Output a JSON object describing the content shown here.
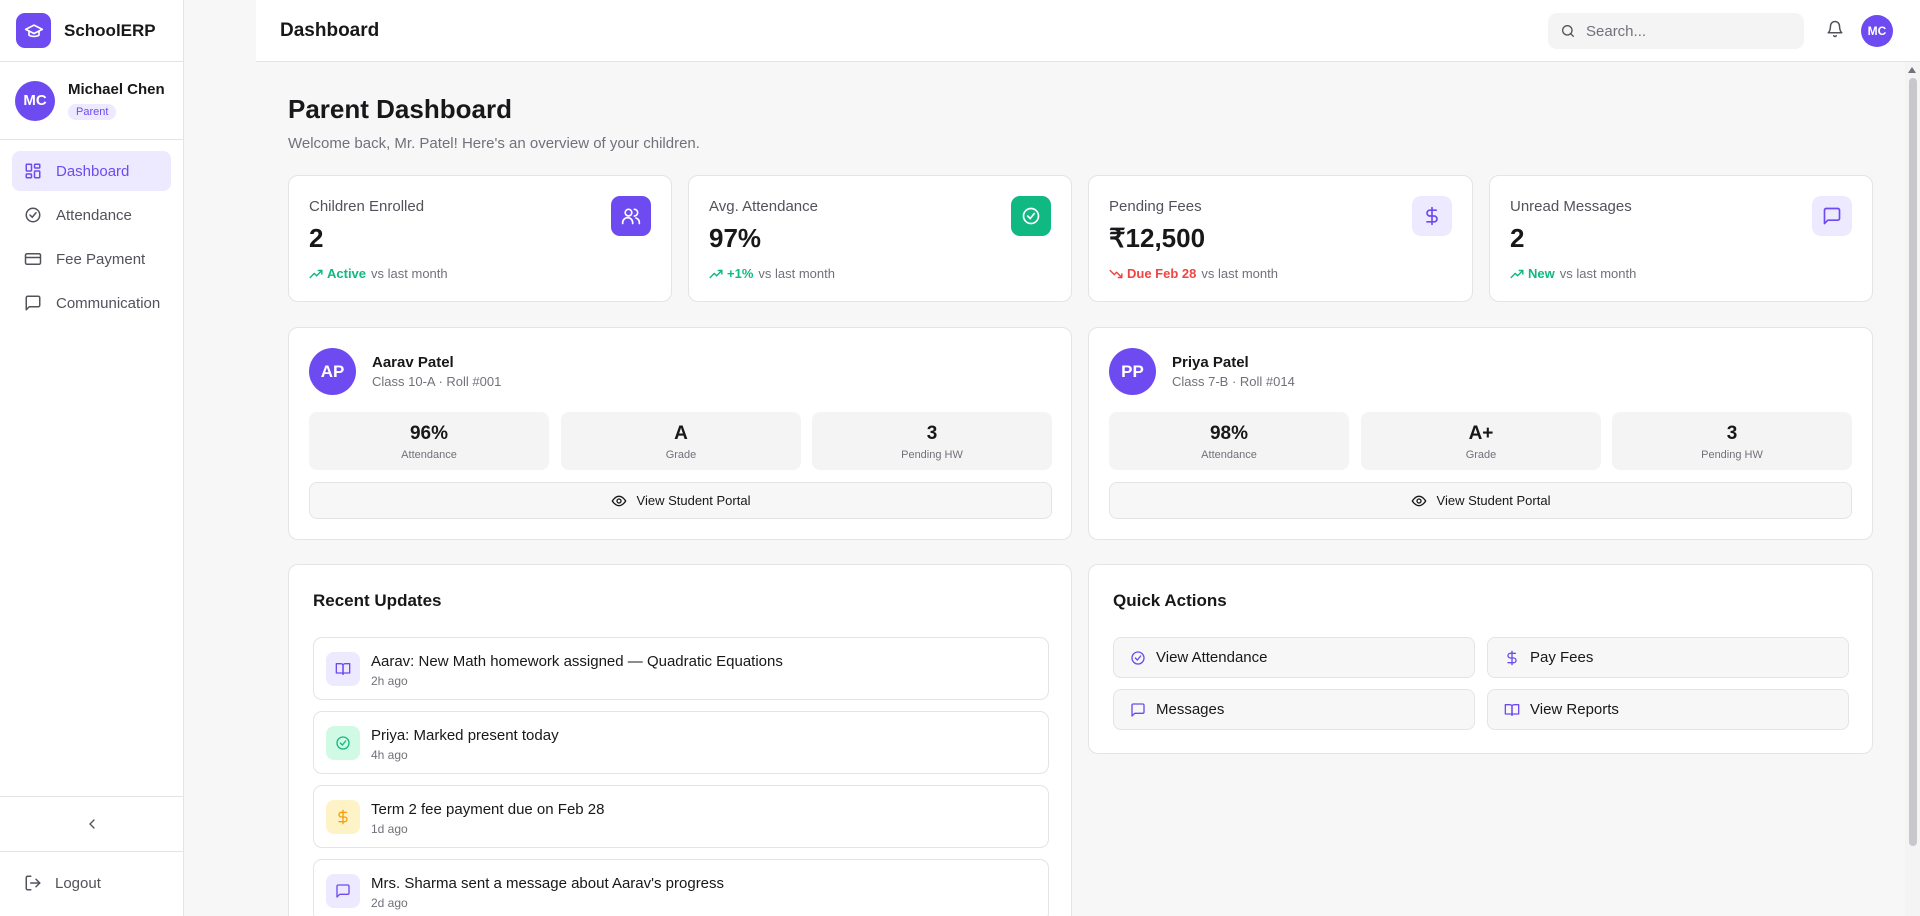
{
  "app": {
    "name": "SchoolERP",
    "logo_icon": "graduation-cap-icon"
  },
  "user": {
    "initials": "MC",
    "name": "Michael Chen",
    "role": "Parent"
  },
  "sidebar": {
    "items": [
      {
        "label": "Dashboard",
        "icon": "dashboard-icon",
        "active": true
      },
      {
        "label": "Attendance",
        "icon": "check-circle-icon",
        "active": false
      },
      {
        "label": "Fee Payment",
        "icon": "credit-card-icon",
        "active": false
      },
      {
        "label": "Communication",
        "icon": "message-icon",
        "active": false
      }
    ],
    "collapse_icon": "chevron-left-icon",
    "logout_label": "Logout"
  },
  "header": {
    "title": "Dashboard",
    "search_placeholder": "Search...",
    "avatar_initials": "MC"
  },
  "page": {
    "title": "Parent Dashboard",
    "subtitle": "Welcome back, Mr. Patel! Here's an overview of your children."
  },
  "stats": [
    {
      "label": "Children Enrolled",
      "value": "2",
      "trend_value": "Active",
      "trend_text": "vs last month",
      "trend": "up",
      "icon": "users-icon",
      "icon_bg": "#6d4bf0"
    },
    {
      "label": "Avg. Attendance",
      "value": "97%",
      "trend_value": "+1%",
      "trend_text": "vs last month",
      "trend": "up",
      "icon": "check-circle-icon",
      "icon_bg": "#10b981"
    },
    {
      "label": "Pending Fees",
      "value": "₹12,500",
      "trend_value": "Due Feb 28",
      "trend_text": "vs last month",
      "trend": "down",
      "icon": "dollar-icon",
      "icon_bg": "#ede9fe"
    },
    {
      "label": "Unread Messages",
      "value": "2",
      "trend_value": "New",
      "trend_text": "vs last month",
      "trend": "up",
      "icon": "message-icon",
      "icon_bg": "#ede9fe"
    }
  ],
  "children": [
    {
      "initials": "AP",
      "name": "Aarav Patel",
      "meta": "Class 10-A · Roll #001",
      "metrics": [
        {
          "value": "96%",
          "label": "Attendance"
        },
        {
          "value": "A",
          "label": "Grade"
        },
        {
          "value": "3",
          "label": "Pending HW"
        }
      ],
      "button": "View Student Portal"
    },
    {
      "initials": "PP",
      "name": "Priya Patel",
      "meta": "Class 7-B · Roll #014",
      "metrics": [
        {
          "value": "98%",
          "label": "Attendance"
        },
        {
          "value": "A+",
          "label": "Grade"
        },
        {
          "value": "3",
          "label": "Pending HW"
        }
      ],
      "button": "View Student Portal"
    }
  ],
  "updates": {
    "title": "Recent Updates",
    "items": [
      {
        "text": "Aarav: New Math homework assigned — Quadratic Equations",
        "time": "2h ago",
        "icon": "book-icon",
        "color": "#6d4bf0"
      },
      {
        "text": "Priya: Marked present today",
        "time": "4h ago",
        "icon": "check-circle-icon",
        "color": "#10b981"
      },
      {
        "text": "Term 2 fee payment due on Feb 28",
        "time": "1d ago",
        "icon": "dollar-icon",
        "color": "#f59e0b"
      },
      {
        "text": "Mrs. Sharma sent a message about Aarav's progress",
        "time": "2d ago",
        "icon": "message-icon",
        "color": "#6d4bf0"
      }
    ]
  },
  "quick_actions": {
    "title": "Quick Actions",
    "items": [
      {
        "label": "View Attendance",
        "icon": "check-circle-icon"
      },
      {
        "label": "Pay Fees",
        "icon": "dollar-icon"
      },
      {
        "label": "Messages",
        "icon": "message-icon"
      },
      {
        "label": "View Reports",
        "icon": "book-icon"
      }
    ]
  },
  "colors": {
    "accent": "#6d4bf0",
    "success": "#10b981",
    "danger": "#ef4444",
    "warning": "#f59e0b"
  }
}
